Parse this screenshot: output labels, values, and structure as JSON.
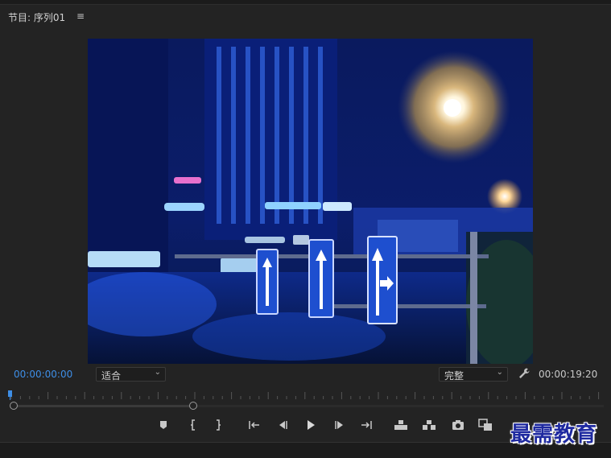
{
  "panel": {
    "title": "节目: 序列01",
    "menu_glyph": "≡"
  },
  "timecode": {
    "current": "00:00:00:00",
    "duration": "00:00:19:20"
  },
  "fit_select": {
    "value": "适合",
    "chevron": "⌄"
  },
  "quality_select": {
    "value": "完整",
    "chevron": "⌄"
  },
  "colors": {
    "accent": "#3e8ee6",
    "panel_bg": "#232323",
    "watermark": "#1f2aa0"
  },
  "controls": [
    "add-marker",
    "mark-in",
    "mark-out",
    "go-to-in",
    "step-back",
    "play",
    "step-forward",
    "go-to-out",
    "lift",
    "extract",
    "export-frame",
    "comparison-view"
  ],
  "watermark": {
    "text": "最需教育"
  }
}
